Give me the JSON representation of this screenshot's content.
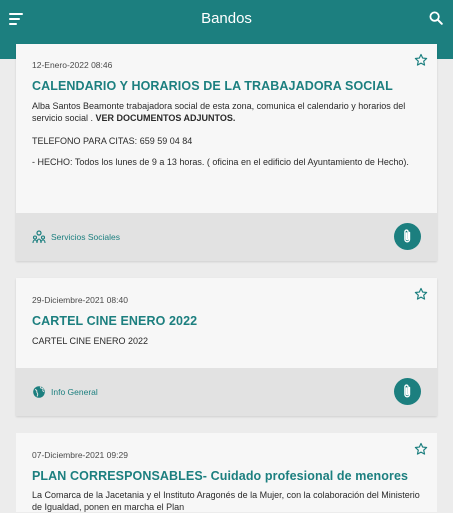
{
  "app": {
    "title": "Bandos",
    "accent_color": "#1c7f7f",
    "menu_icon": "menu-icon",
    "search_icon": "search-icon"
  },
  "cards": [
    {
      "date": "12-Enero-2022 08:46",
      "title": "CALENDARIO Y HORARIOS DE LA TRABAJADORA SOCIAL",
      "intro": "Alba Santos Beamonte trabajadora social de esta zona, comunica el calendario y horarios del servicio social .",
      "intro_bold": "VER DOCUMENTOS ADJUNTOS.",
      "phone": "TELEFONO PARA CITAS: 659 59 04 84",
      "schedule": "- HECHO: Todos los lunes de 9 a 13 horas. ( oficina en el edificio del Ayuntamiento de Hecho).",
      "category": "Servicios Sociales",
      "category_icon": "social-services-icon"
    },
    {
      "date": "29-Diciembre-2021 08:40",
      "title": "CARTEL CINE ENERO 2022",
      "text": "CARTEL CINE ENERO 2022",
      "category": "Info General",
      "category_icon": "globe-icon"
    },
    {
      "date": "07-Diciembre-2021 09:29",
      "title": "PLAN CORRESPONSABLES- Cuidado profesional de menores",
      "text": "La Comarca de la Jacetania y el Instituto Aragonés de la Mujer, con la colaboración del Ministerio de Igualdad, ponen en marcha el Plan"
    }
  ]
}
